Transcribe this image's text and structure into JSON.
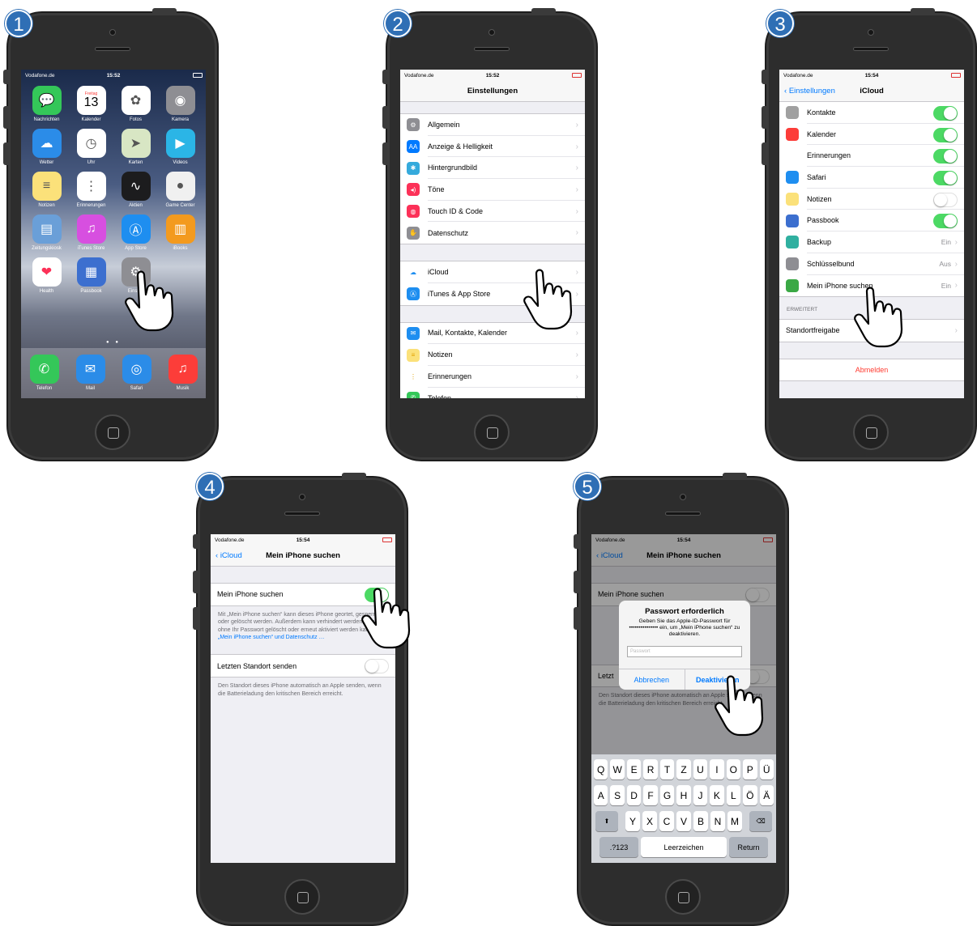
{
  "carrier": "Vodafone.de",
  "steps": [
    "1",
    "2",
    "3",
    "4",
    "5"
  ],
  "screen1": {
    "time": "15:52",
    "date_day": "Freitag",
    "date_num": "13",
    "apps": [
      {
        "label": "Nachrichten",
        "icon": "messages-icon",
        "color": "#34c759",
        "glyph": "💬"
      },
      {
        "label": "Kalender",
        "icon": "calendar-icon",
        "color": "#ffffff",
        "glyph": ""
      },
      {
        "label": "Fotos",
        "icon": "photos-icon",
        "color": "#ffffff",
        "glyph": "✿"
      },
      {
        "label": "Kamera",
        "icon": "camera-icon",
        "color": "#8e8e93",
        "glyph": "◉"
      },
      {
        "label": "Wetter",
        "icon": "weather-icon",
        "color": "#2b8ce8",
        "glyph": "☁"
      },
      {
        "label": "Uhr",
        "icon": "clock-icon",
        "color": "#ffffff",
        "glyph": "◷"
      },
      {
        "label": "Karten",
        "icon": "maps-icon",
        "color": "#d8e6c4",
        "glyph": "➤"
      },
      {
        "label": "Videos",
        "icon": "videos-icon",
        "color": "#2bb5e6",
        "glyph": "▶"
      },
      {
        "label": "Notizen",
        "icon": "notes-icon",
        "color": "#fbe17a",
        "glyph": "≡"
      },
      {
        "label": "Erinnerungen",
        "icon": "reminders-icon",
        "color": "#ffffff",
        "glyph": "⋮"
      },
      {
        "label": "Aktien",
        "icon": "stocks-icon",
        "color": "#1c1c1e",
        "glyph": "∿"
      },
      {
        "label": "Game Center",
        "icon": "game-center-icon",
        "color": "#f0f0f0",
        "glyph": "●"
      },
      {
        "label": "Zeitungskiosk",
        "icon": "newsstand-icon",
        "color": "#6a9fd8",
        "glyph": "▤"
      },
      {
        "label": "iTunes Store",
        "icon": "itunes-store-icon",
        "color": "#d74fe0",
        "glyph": "♫"
      },
      {
        "label": "App Store",
        "icon": "app-store-icon",
        "color": "#1e8ef0",
        "glyph": "Ⓐ"
      },
      {
        "label": "iBooks",
        "icon": "ibooks-icon",
        "color": "#f39a1e",
        "glyph": "▥"
      },
      {
        "label": "Health",
        "icon": "health-icon",
        "color": "#ffffff",
        "glyph": "❤"
      },
      {
        "label": "Passbook",
        "icon": "passbook-icon",
        "color": "#3c6fcf",
        "glyph": "▦"
      },
      {
        "label": "Einstell",
        "icon": "settings-icon",
        "color": "#8e8e93",
        "glyph": "⚙"
      }
    ],
    "dock": [
      {
        "label": "Telefon",
        "icon": "phone-icon",
        "color": "#34c759",
        "glyph": "✆"
      },
      {
        "label": "Mail",
        "icon": "mail-icon",
        "color": "#2b8ce8",
        "glyph": "✉"
      },
      {
        "label": "Safari",
        "icon": "safari-icon",
        "color": "#2b8ce8",
        "glyph": "◎"
      },
      {
        "label": "Musik",
        "icon": "music-icon",
        "color": "#fc3d39",
        "glyph": "♫"
      }
    ]
  },
  "screen2": {
    "time": "15:52",
    "title": "Einstellungen",
    "group1": [
      {
        "label": "Allgemein",
        "icon": "gear-icon",
        "color": "#8e8e93",
        "glyph": "⚙"
      },
      {
        "label": "Anzeige & Helligkeit",
        "icon": "display-icon",
        "color": "#007aff",
        "glyph": "AA"
      },
      {
        "label": "Hintergrundbild",
        "icon": "wallpaper-icon",
        "color": "#35aadc",
        "glyph": "✱"
      },
      {
        "label": "Töne",
        "icon": "sounds-icon",
        "color": "#fc3158",
        "glyph": "◂)"
      },
      {
        "label": "Touch ID & Code",
        "icon": "fingerprint-icon",
        "color": "#fc3158",
        "glyph": "◍"
      },
      {
        "label": "Datenschutz",
        "icon": "privacy-hand-icon",
        "color": "#8e8e93",
        "glyph": "✋"
      }
    ],
    "group2": [
      {
        "label": "iCloud",
        "icon": "icloud-icon",
        "color": "#ffffff",
        "glyph": "☁"
      },
      {
        "label": "iTunes & App Store",
        "icon": "app-store-icon",
        "color": "#1e8ef0",
        "glyph": "Ⓐ"
      }
    ],
    "group3": [
      {
        "label": "Mail, Kontakte, Kalender",
        "icon": "mail-icon",
        "color": "#1e8ef0",
        "glyph": "✉"
      },
      {
        "label": "Notizen",
        "icon": "notes-icon",
        "color": "#fbe17a",
        "glyph": "≡"
      },
      {
        "label": "Erinnerungen",
        "icon": "reminders-icon",
        "color": "#ffffff",
        "glyph": "⋮"
      },
      {
        "label": "Telefon",
        "icon": "phone-icon",
        "color": "#34c759",
        "glyph": "✆"
      }
    ]
  },
  "screen3": {
    "time": "15:54",
    "back": "Einstellungen",
    "title": "iCloud",
    "rows": [
      {
        "label": "Kontakte",
        "icon": "contacts-icon",
        "color": "#a0a0a0",
        "toggle": "on"
      },
      {
        "label": "Kalender",
        "icon": "calendar-icon",
        "color": "#fc3d39",
        "toggle": "on"
      },
      {
        "label": "Erinnerungen",
        "icon": "reminders-icon",
        "color": "#ffffff",
        "toggle": "on"
      },
      {
        "label": "Safari",
        "icon": "safari-icon",
        "color": "#1e8ef0",
        "toggle": "on"
      },
      {
        "label": "Notizen",
        "icon": "notes-icon",
        "color": "#fbe17a",
        "toggle": "off"
      },
      {
        "label": "Passbook",
        "icon": "passbook-icon",
        "color": "#3c6fcf",
        "toggle": "on"
      },
      {
        "label": "Backup",
        "icon": "backup-icon",
        "color": "#30b0a0",
        "value": "Ein"
      },
      {
        "label": "Schlüsselbund",
        "icon": "keychain-icon",
        "color": "#8e8e93",
        "value": "Aus"
      },
      {
        "label": "Mein iPhone suchen",
        "icon": "find-my-iphone-icon",
        "color": "#3aa845",
        "value": "Ein"
      }
    ],
    "section": "ERWEITERT",
    "location": "Standortfreigabe",
    "signout": "Abmelden"
  },
  "screen4": {
    "time": "15:54",
    "back": "iCloud",
    "title": "Mein iPhone suchen",
    "row1": "Mein iPhone suchen",
    "note1_text": "Mit „Mein iPhone suchen“ kann dieses iPhone geortet, gesperrt oder gelöscht werden. Außerdem kann verhindert werden, dass es ohne Ihr Passwort gelöscht oder erneut aktiviert werden kann. ",
    "note1_link": "„Mein iPhone suchen“ und Datenschutz …",
    "row2": "Letzten Standort senden",
    "note2": "Den Standort dieses iPhone automatisch an Apple senden, wenn die Batterieladung den kritischen Bereich erreicht."
  },
  "screen5": {
    "time": "15:54",
    "dialog_title": "Passwort erforderlich",
    "dialog_msg": "Geben Sie das Apple-ID-Passwort für ••••••••••••••• ein, um „Mein iPhone suchen“ zu deaktivieren.",
    "placeholder": "Passwort",
    "cancel": "Abbrechen",
    "confirm": "Deaktivieren",
    "row_visible": "Mein iPhone suchen",
    "row2_partial": "Letzt",
    "note_partial": "Den Standort dieses iPhone automatisch an Apple senden, wenn die Batterieladung den kritischen Bereich erreicht.",
    "keys_row1": [
      "Q",
      "W",
      "E",
      "R",
      "T",
      "Z",
      "U",
      "I",
      "O",
      "P",
      "Ü"
    ],
    "keys_row2": [
      "A",
      "S",
      "D",
      "F",
      "G",
      "H",
      "J",
      "K",
      "L",
      "Ö",
      "Ä"
    ],
    "keys_row3": [
      "Y",
      "X",
      "C",
      "V",
      "B",
      "N",
      "M"
    ],
    "shift": "⬆",
    "delete": "⌫",
    "num": ".?123",
    "space": "Leerzeichen",
    "return": "Return"
  }
}
